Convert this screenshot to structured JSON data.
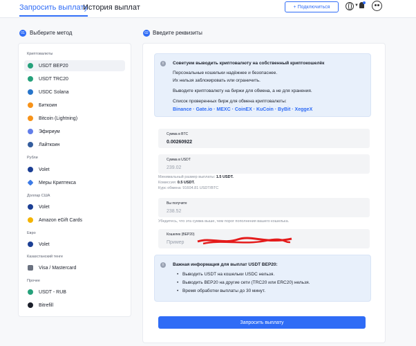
{
  "tabs": [
    {
      "label": "Запросить выплату",
      "active": true
    },
    {
      "label": "История выплат",
      "active": false
    }
  ],
  "header": {
    "subscribe_label": "+ Подключиться"
  },
  "left": {
    "step_number": "01",
    "step_title": "Выберите метод",
    "groups": {
      "crypto": "Криптовалюты",
      "rubles": "Рубли",
      "usd": "Доллар США",
      "euro": "Евро",
      "kzt": "Казахстанский тенге",
      "other": "Прочее"
    },
    "methods": {
      "usdt_bep20": "USDT BEP20",
      "usdt_trc20": "USDT TRC20",
      "usdc_solana": "USDC Solana",
      "bitcoin": "Биткоин",
      "bitcoin_ln": "Bitcoin (Lightning)",
      "ethereum": "Эфириум",
      "litecoin": "Лайткоин",
      "volet_rub": "Volet",
      "meры": "Меры Криптекса",
      "volet_usd": "Volet",
      "amazon": "Amazon eGift Cards",
      "volet_eur": "Volet",
      "visa": "Visa / Mastercard",
      "usdt_rub": "USDT - RUB",
      "bitrefill": "Bitrefill"
    },
    "icon_colors": {
      "usdt": "#26a17b",
      "trc": "#e50914",
      "usdc": "#2775ca",
      "btc": "#f7931a",
      "eth": "#627eea",
      "ltc": "#345d9d",
      "volet": "#1c3f94",
      "mery": "#3d7be6",
      "amazon": "#f4b400",
      "visa": "#6b7280",
      "bitrefill": "#1b1f2a"
    }
  },
  "right": {
    "step_number": "02",
    "step_title": "Введите реквизиты",
    "tip": {
      "title": "Советуем выводить криптовалюту на собственный криптокошелёк",
      "line1": "Персональные кошельки надёжнее и безопаснее.",
      "line2": "Их нельзя заблокировать или ограничить.",
      "line3": "Выводите криптовалюту на биржи для обмена, а не для хранения.",
      "line4": "Список проверенных бирж для обмена криптовалюты:",
      "exchanges": "Binance · Gate.io · MEXC · CoinEX · KuCoin · ByBit · XeggeX"
    },
    "btc_field": {
      "label": "Сумма в BTC",
      "value": "0.00260922"
    },
    "usdt_field": {
      "label": "Сумма в USDT",
      "value": "239.02"
    },
    "hints": {
      "min_prefix": "Минимальный размер выплаты: ",
      "min_value": "1.5 USDT.",
      "fee_prefix": "Комиссия: ",
      "fee_value": "0.5 USDT.",
      "rate": "Курс обмена: 91604.81 USDT/BTC"
    },
    "receive_field": {
      "label": "Вы получите",
      "value": "238.52"
    },
    "receive_hint": "Убедитесь, что эта сумма выше, чем порог пополнения вашего кошелька.",
    "wallet_field": {
      "label": "Кошелек (BEP20)",
      "placeholder": "Пример"
    },
    "important": {
      "title": "Важная информация для выплат USDT BEP20:",
      "items": [
        "Выводить USDT на кошельки USDC нельзя.",
        "Выводить BEP20 на другие сети (TRC20 или ERC20) нельзя.",
        "Время обработки выплаты до 30 минут."
      ]
    },
    "submit_label": "Запросить выплату"
  }
}
